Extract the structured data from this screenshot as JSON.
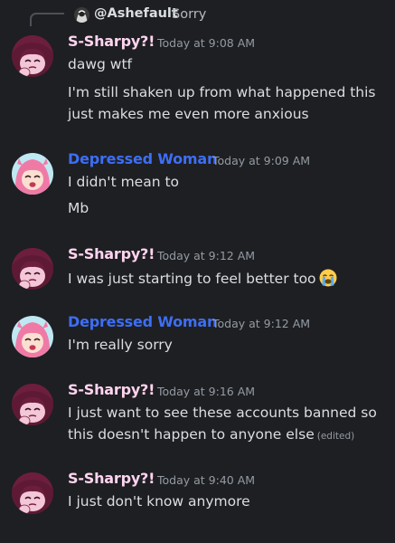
{
  "reply": {
    "username": "@Ashefault",
    "text": "Sorry"
  },
  "colors": {
    "background": "#1e1f22",
    "sharpy_name": "#ffd4f0",
    "depressed_name": "#3d6ef5",
    "timestamp": "#949ba4",
    "message_text": "#dbdee1"
  },
  "messages": [
    {
      "author": "S-Sharpy?!",
      "timestamp": "Today at 9:08 AM",
      "avatar_icon": "maroon-character-avatar",
      "lines": [
        "dawg wtf",
        "I'm still shaken up from what happened this",
        "just makes me even more anxious"
      ]
    },
    {
      "author": "Depressed Woman",
      "timestamp": "Today at 9:09 AM",
      "avatar_icon": "pink-haired-character-avatar",
      "lines": [
        "I didn't mean to",
        "Mb"
      ]
    },
    {
      "author": "S-Sharpy?!",
      "timestamp": "Today at 9:12 AM",
      "avatar_icon": "maroon-character-avatar",
      "lines": [
        "I was just starting to feel better too"
      ],
      "emoji": "loudly-crying-face-emoji"
    },
    {
      "author": "Depressed Woman",
      "timestamp": "Today at 9:12 AM",
      "avatar_icon": "pink-haired-character-avatar",
      "lines": [
        "I'm really sorry"
      ]
    },
    {
      "author": "S-Sharpy?!",
      "timestamp": "Today at 9:16 AM",
      "avatar_icon": "maroon-character-avatar",
      "lines": [
        "I just want to see these accounts banned so",
        "this doesn't happen to anyone else"
      ],
      "edited_label": "(edited)"
    },
    {
      "author": "S-Sharpy?!",
      "timestamp": "Today at 9:40 AM",
      "avatar_icon": "maroon-character-avatar",
      "lines": [
        "I just don't know anymore"
      ]
    }
  ]
}
